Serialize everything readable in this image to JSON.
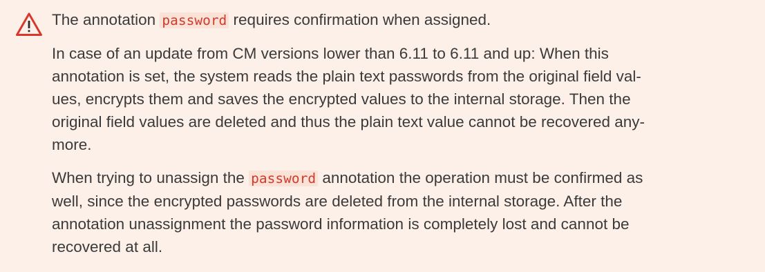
{
  "notice": {
    "icon": "warning-triangle-icon",
    "accent_color": "#d9372b",
    "background_color": "#fdf0e8",
    "code_color": "#cf3b2c",
    "line1": {
      "pre": "The annotation ",
      "code": "password",
      "post": " requires confirmation when assigned."
    },
    "para2": {
      "l1": "In case of an update from CM versions lower than 6.11 to 6.11 and up: When this",
      "l2": "annotation is set, the system reads the plain text passwords from the original field val-",
      "l3": "ues, encrypts them and saves the encrypted values to the internal storage. Then the",
      "l4": "original field values are deleted and thus the plain text value cannot be recovered any-",
      "l5": "more."
    },
    "para3": {
      "l1_pre": "When trying to unassign the ",
      "l1_code": "password",
      "l1_post": " annotation the operation must be confirmed as",
      "l2": "well, since the encrypted passwords are deleted from the internal storage. After the",
      "l3": "annotation unassignment the password information is completely lost and cannot be",
      "l4": "recovered at all."
    }
  }
}
